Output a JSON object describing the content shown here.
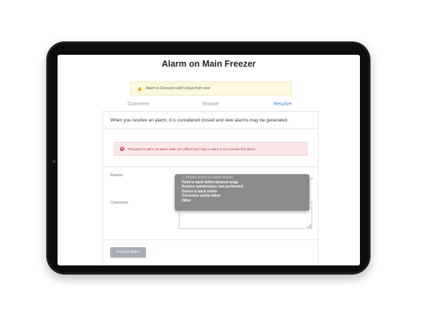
{
  "page": {
    "title": "Alarm on Main Freezer"
  },
  "banner": {
    "text": "Alarm is Snoozed until 5 days from now",
    "icon": "warning-icon"
  },
  "tabs": [
    {
      "label": "Comment",
      "active": false
    },
    {
      "label": "Snooze",
      "active": false
    },
    {
      "label": "Resolve",
      "active": true
    }
  ],
  "resolve": {
    "intro": "When you resolve an alarm, it is considered closed and new alarms may be generated.",
    "error": "This point is still in an alarm state (it's offline) and may re-alarm if you resolve this alarm.",
    "reason_label": "Reason",
    "comments_label": "Comments",
    "reason_options": [
      "Please select an alarm reason",
      "Point is back within desired range",
      "Routine maintenance was performed",
      "Device is back online",
      "Corrective action taken",
      "Other"
    ],
    "selected_check": "✓",
    "button_label": "Resolve Alarm"
  },
  "colors": {
    "accent": "#3d8bd8",
    "warning": "#e6a317",
    "error": "#d9434b",
    "device": "#1e1e20"
  }
}
